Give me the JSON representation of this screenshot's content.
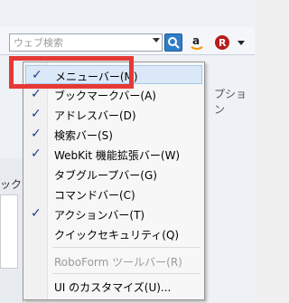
{
  "toolbar": {
    "search_placeholder": "ウェブ検索",
    "search_icon": "magnifier-icon",
    "amazon_icon": "amazon-icon",
    "roboform_icon": "roboform-icon",
    "more_icon": "dropdown-arrow-icon"
  },
  "background": {
    "right_partial": "プション",
    "left_partial": "ック"
  },
  "menu": {
    "items": [
      {
        "label": "メニューバー(M)",
        "checked": true
      },
      {
        "label": "ブックマークバー(A)",
        "checked": true
      },
      {
        "label": "アドレスバー(D)",
        "checked": true
      },
      {
        "label": "検索バー(S)",
        "checked": true
      },
      {
        "label": "WebKit 機能拡張バー(W)",
        "checked": true
      },
      {
        "label": "タブグループバー(G)",
        "checked": false
      },
      {
        "label": "コマンドバー(C)",
        "checked": false
      },
      {
        "label": "アクションバー(T)",
        "checked": true
      },
      {
        "label": "クイックセキュリティ(Q)",
        "checked": false
      },
      {
        "label": "RoboForm ツールバー(R)",
        "checked": false,
        "disabled": true
      },
      {
        "label": "UI のカスタマイズ(U)...",
        "checked": false
      }
    ],
    "check_glyph": "✓"
  },
  "colors": {
    "highlight_outline": "#e53935",
    "check": "#1b3e8f"
  }
}
